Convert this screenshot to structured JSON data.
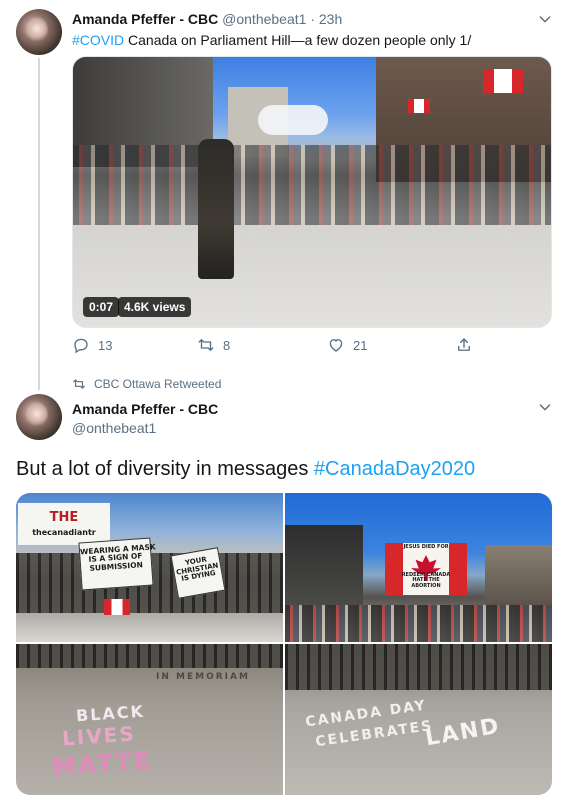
{
  "tweet1": {
    "author_name": "Amanda Pfeffer - CBC",
    "author_handle": "@onthebeat1",
    "time": "23h",
    "hashtag": "#COVID",
    "text": " Canada on Parliament Hill—a few dozen people only  1/",
    "video": {
      "duration": "0:07",
      "views": "4.6K views"
    },
    "actions": {
      "replies": "13",
      "retweets": "8",
      "likes": "21"
    }
  },
  "retweet_banner": {
    "text": "CBC Ottawa Retweeted"
  },
  "tweet2": {
    "author_name": "Amanda Pfeffer - CBC",
    "author_handle": "@onthebeat1",
    "text": "But a lot of diversity in messages ",
    "hashtag": "#CanadaDay2020",
    "photos": {
      "sign_mask_line1": "WEARING A MASK",
      "sign_mask_line2": "IS A SIGN OF",
      "sign_mask_line3": "SUBMISSION",
      "sign_panel": "THE",
      "sign_panel_sub": "thecanadiantr",
      "sign_right_line1": "YOUR",
      "sign_right_line2": "CHRISTIAN",
      "sign_right_line3": "IS DYING",
      "flag_line1": "JESUS DIED FOR",
      "flag_line2": "REDEEM CANADA",
      "flag_line3": "HATE THE",
      "flag_line4": "ABORTION",
      "chalk_top": "IN MEMORIAM",
      "chalk_black": "BLACK",
      "chalk_lives": "LIVES",
      "chalk_matter": "MATTE",
      "chalk_canada_day": "CANADA DAY",
      "chalk_celebrates": "CELEBRATES",
      "chalk_land": "LAND"
    }
  },
  "colors": {
    "link": "#1da1f2",
    "secondary_text": "#5b7083",
    "primary_text": "#14171a"
  }
}
